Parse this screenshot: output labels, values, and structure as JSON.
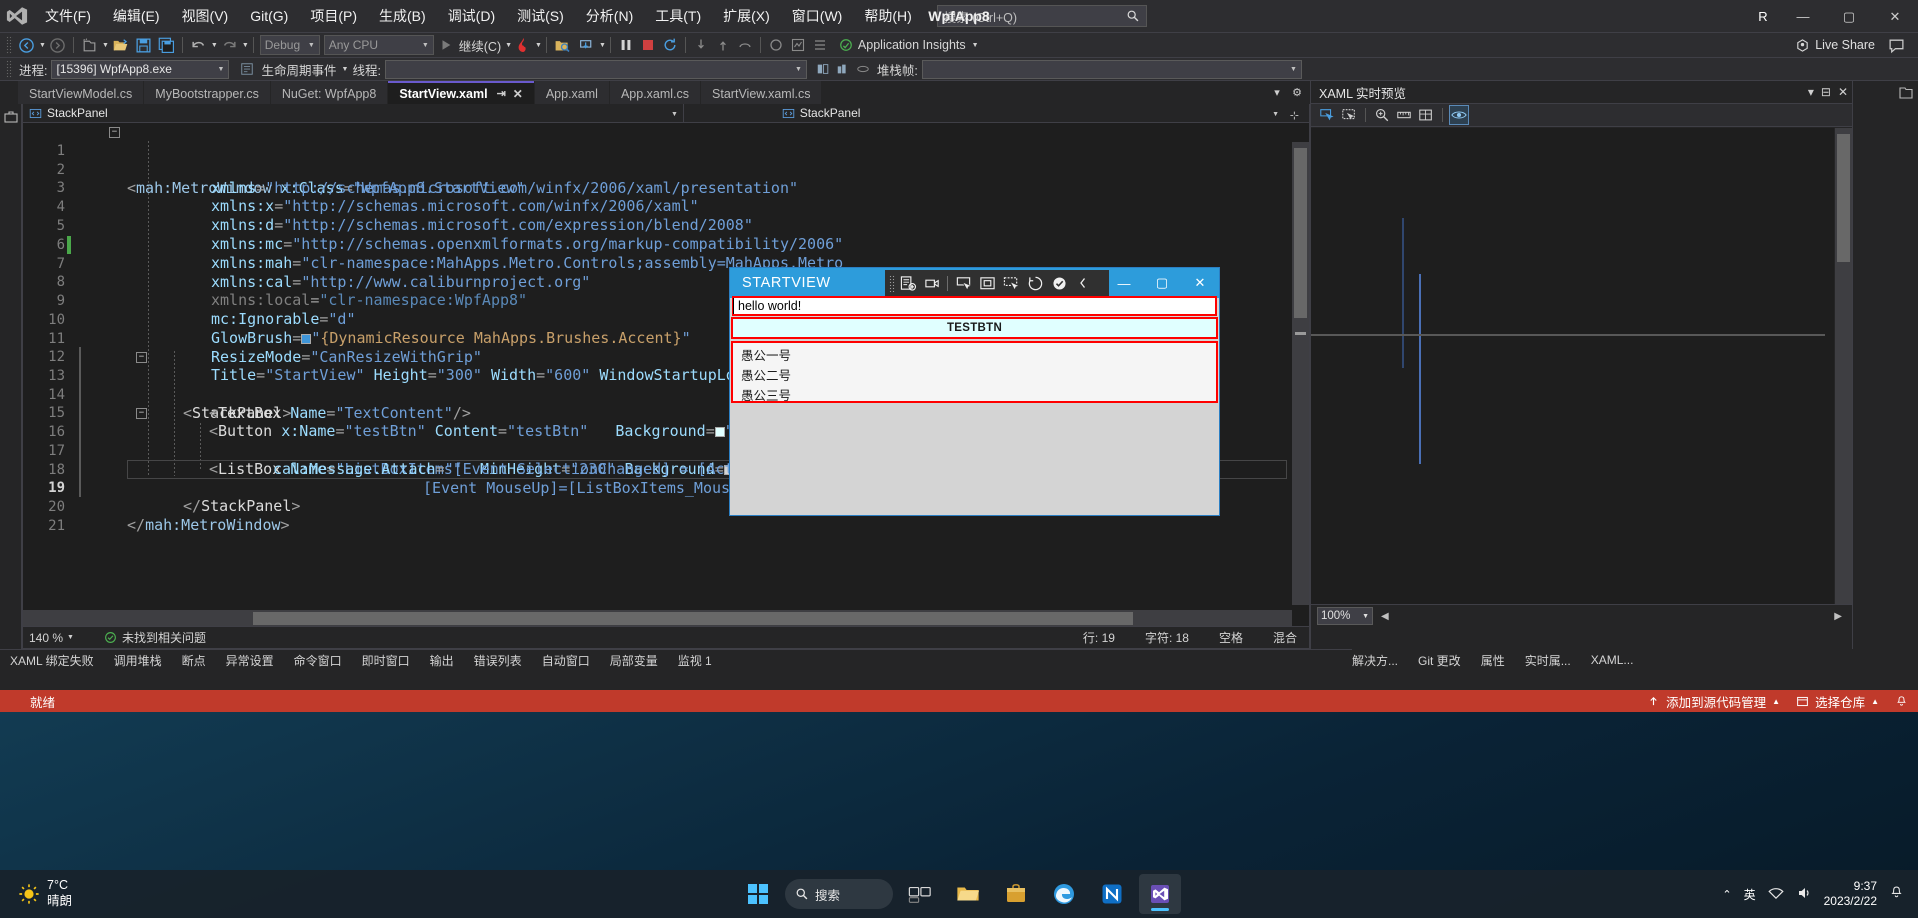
{
  "titlebar": {
    "menus": [
      "文件(F)",
      "编辑(E)",
      "视图(V)",
      "Git(G)",
      "项目(P)",
      "生成(B)",
      "调试(D)",
      "测试(S)",
      "分析(N)",
      "工具(T)",
      "扩展(X)",
      "窗口(W)",
      "帮助(H)"
    ],
    "search_placeholder": "搜索 (Ctrl+Q)",
    "window_title": "WpfApp8",
    "account_initial": "R",
    "minimize": "—",
    "maximize": "▢",
    "close": "✕"
  },
  "toolbar": {
    "config": "Debug",
    "platform": "Any CPU",
    "run_label": "继续(C)",
    "app_insights": "Application Insights",
    "live_share": "Live Share"
  },
  "debugbar": {
    "process_label": "进程:",
    "process_value": "[15396] WpfApp8.exe",
    "lifecycle_label": "生命周期事件",
    "thread_label": "线程:",
    "thread_value": "",
    "stackframe_label": "堆栈帧:",
    "stackframe_value": ""
  },
  "tabs": [
    {
      "label": "StartViewModel.cs",
      "active": false
    },
    {
      "label": "MyBootstrapper.cs",
      "active": false
    },
    {
      "label": "NuGet: WpfApp8",
      "active": false
    },
    {
      "label": "StartView.xaml",
      "active": true
    },
    {
      "label": "App.xaml",
      "active": false
    },
    {
      "label": "App.xaml.cs",
      "active": false
    },
    {
      "label": "StartView.xaml.cs",
      "active": false
    }
  ],
  "editor": {
    "nav_left": "StackPanel",
    "nav_right": "StackPanel",
    "lines": [
      {
        "n": "1",
        "fold": "−",
        "indent": 0
      },
      {
        "n": "2",
        "fold": "",
        "indent": 1
      },
      {
        "n": "3",
        "fold": "",
        "indent": 1
      },
      {
        "n": "4",
        "fold": "",
        "indent": 1
      },
      {
        "n": "5",
        "fold": "",
        "indent": 1
      },
      {
        "n": "6",
        "fold": "",
        "indent": 1
      },
      {
        "n": "7",
        "fold": "",
        "indent": 1
      },
      {
        "n": "8",
        "fold": "",
        "indent": 1
      },
      {
        "n": "9",
        "fold": "",
        "indent": 1
      },
      {
        "n": "10",
        "fold": "",
        "indent": 1
      },
      {
        "n": "11",
        "fold": "",
        "indent": 1
      },
      {
        "n": "12",
        "fold": "",
        "indent": 1
      },
      {
        "n": "13",
        "fold": "−",
        "indent": 1
      },
      {
        "n": "14",
        "fold": "",
        "indent": 2
      },
      {
        "n": "15",
        "fold": "",
        "indent": 2
      },
      {
        "n": "16",
        "fold": "−",
        "indent": 2
      },
      {
        "n": "17",
        "fold": "",
        "indent": 3
      },
      {
        "n": "18",
        "fold": "",
        "indent": 3
      },
      {
        "n": "19",
        "fold": "",
        "indent": 1
      },
      {
        "n": "20",
        "fold": "",
        "indent": 0
      },
      {
        "n": "21",
        "fold": "",
        "indent": 0
      }
    ],
    "code": [
      "<mah:MetroWindow x:Class=\"WpfApp8.StartView\"",
      "xmlns=\"http://schemas.microsoft.com/winfx/2006/xaml/presentation\"",
      "xmlns:x=\"http://schemas.microsoft.com/winfx/2006/xaml\"",
      "xmlns:d=\"http://schemas.microsoft.com/expression/blend/2008\"",
      "xmlns:mc=\"http://schemas.openxmlformats.org/markup-compatibility/2006\"",
      "xmlns:mah=\"clr-namespace:MahApps.Metro.Controls;assembly=MahApps.Metro\"",
      "xmlns:cal=\"http://www.caliburnproject.org\"",
      "xmlns:local=\"clr-namespace:WpfApp8\"",
      "mc:Ignorable=\"d\"",
      "GlowBrush=\"{DynamicResource MahApps.Brushes.Accent}\"",
      "ResizeMode=\"CanResizeWithGrip\"",
      "Title=\"StartView\" Height=\"300\" Width=\"600\" WindowStartupLocation=\"CenterS",
      "<StackPanel>",
      "<TextBox Name=\"TextContent\"/>",
      "<Button x:Name=\"testBtn\" Content=\"testBtn\"   Background=\"LightCyan\"/>",
      "<ListBox Name=\"ListBoxItems\"  MinHeight=\"230\" Background=\"LightGray\"",
      "cal:Message.Attach=\"[Event SelectionChanged] = [Action ListBoxIt",
      "[Event MouseUp]=[ListBoxItems_MouseUp($sourc",
      "</StackPanel>",
      "</mah:MetroWindow>",
      ""
    ],
    "zoom": "140 %",
    "issues": "未找到相关问题",
    "line_indicator": "行: 19",
    "col_indicator": "字符: 18",
    "spaces": "空格",
    "encoding": "混合"
  },
  "wpf_window": {
    "title": "STARTVIEW",
    "textbox_value": "hello world!",
    "button_label": "TESTBTN",
    "listbox_items": [
      "愚公一号",
      "愚公二号",
      "愚公三号"
    ],
    "minimize": "—",
    "maximize": "▢",
    "close": "✕",
    "accent_color": "#2d9cdb",
    "highlight_color": "#ff0000"
  },
  "right_panel": {
    "title": "XAML 实时预览",
    "zoom": "100%",
    "pin": "⊟",
    "close": "✕",
    "menu": "▾"
  },
  "far_strip": {
    "label": "工具箱"
  },
  "bottom_dock": {
    "items": [
      "XAML 绑定失败",
      "调用堆栈",
      "断点",
      "异常设置",
      "命令窗口",
      "即时窗口",
      "输出",
      "错误列表",
      "自动窗口",
      "局部变量",
      "监视 1"
    ]
  },
  "bottom_status": {
    "right_items": [
      "解决方...",
      "Git 更改",
      "属性",
      "实时属...",
      "XAML..."
    ]
  },
  "statusbar": {
    "ready": "就绪",
    "source_control": "添加到源代码管理",
    "repo": "选择仓库"
  },
  "taskbar": {
    "weather_temp": "7°C",
    "weather_desc": "晴朗",
    "search_label": "搜索",
    "clock_time": "9:37",
    "clock_date": "2023/2/22",
    "lang": "英",
    "chevron": "⌃"
  },
  "colors": {
    "vs_chrome": "#2d2d30",
    "vs_editor_bg": "#1e1e1e",
    "accent_tab": "#6a5acd",
    "status_red": "#c03a2b",
    "wpf_accent": "#2d9cdb",
    "alert_red": "#ff0000"
  }
}
